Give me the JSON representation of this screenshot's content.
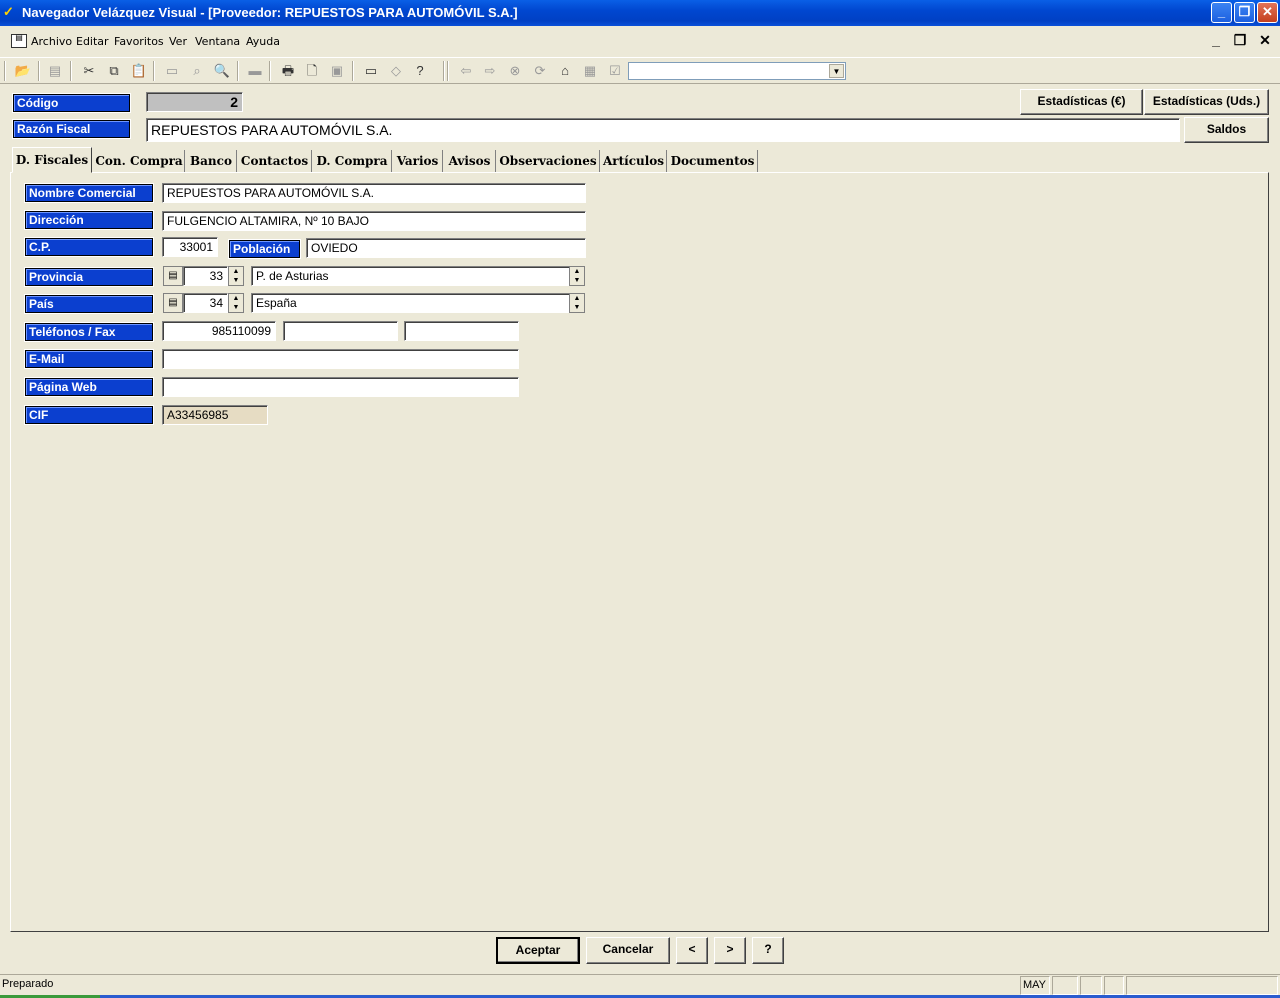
{
  "window": {
    "title": "Navegador Velázquez Visual - [Proveedor: REPUESTOS PARA AUTOMÓVIL S.A.]"
  },
  "menu": [
    "Archivo",
    "Editar",
    "Favoritos",
    "Ver",
    "Ventana",
    "Ayuda"
  ],
  "header": {
    "codigo_label": "Código",
    "codigo_value": "2",
    "razon_label": "Razón Fiscal",
    "razon_value": "REPUESTOS PARA AUTOMÓVIL S.A.",
    "btn_estad_eur": "Estadísticas (€)",
    "btn_estad_uds": "Estadísticas (Uds.)",
    "btn_saldos": "Saldos"
  },
  "tabs": [
    "D. Fiscales",
    "Con. Compra",
    "Banco",
    "Contactos",
    "D. Compra",
    "Varios",
    "Avisos",
    "Observaciones",
    "Artículos",
    "Documentos"
  ],
  "form": {
    "nombre_comercial_label": "Nombre Comercial",
    "nombre_comercial": "REPUESTOS PARA AUTOMÓVIL S.A.",
    "direccion_label": "Dirección",
    "direccion": "FULGENCIO ALTAMIRA, Nº 10 BAJO",
    "cp_label": "C.P.",
    "cp": "33001",
    "poblacion_label": "Población",
    "poblacion": "OVIEDO",
    "provincia_label": "Provincia",
    "provincia_code": "33",
    "provincia_name": "P. de Asturias",
    "pais_label": "País",
    "pais_code": "34",
    "pais_name": "España",
    "telefonos_label": "Teléfonos / Fax",
    "telefono1": "985110099",
    "telefono2": "",
    "fax": "",
    "email_label": "E-Mail",
    "email": "",
    "web_label": "Página Web",
    "web": "",
    "cif_label": "CIF",
    "cif": "A33456985"
  },
  "footer": {
    "aceptar": "Aceptar",
    "cancelar": "Cancelar",
    "prev": "<",
    "next": ">",
    "help": "?"
  },
  "status": {
    "text": "Preparado",
    "may": "MAY"
  }
}
